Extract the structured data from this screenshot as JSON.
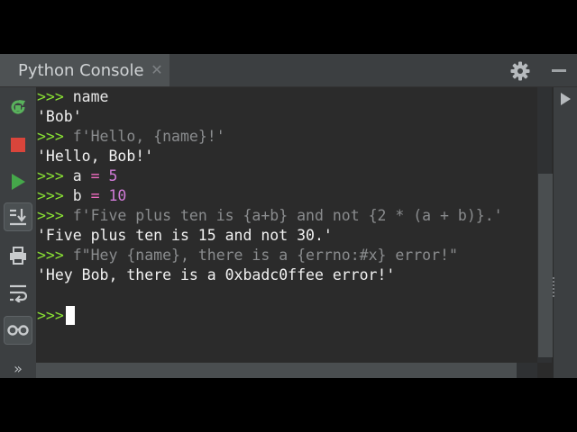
{
  "tab": {
    "title": "Python Console",
    "close_glyph": "✕"
  },
  "toolbar": {
    "icons": [
      "rerun-icon",
      "stop-icon",
      "run-icon",
      "scroll-to-end-icon",
      "print-icon",
      "soft-wrap-icon",
      "variables-icon",
      "more-icon"
    ],
    "more_glyph": "»"
  },
  "console": {
    "prompt": ">>>",
    "lines": [
      {
        "kind": "input",
        "text": " name"
      },
      {
        "kind": "output",
        "text": "'Bob'"
      },
      {
        "kind": "input",
        "text": " f'Hello, {name}!'"
      },
      {
        "kind": "output",
        "text": "'Hello, Bob!'"
      },
      {
        "kind": "assign",
        "var": " a ",
        "op": "=",
        "value": " 5"
      },
      {
        "kind": "assign",
        "var": " b ",
        "op": "=",
        "value": " 10"
      },
      {
        "kind": "input",
        "text": " f'Five plus ten is {a+b} and not {2 * (a + b)}.'"
      },
      {
        "kind": "output",
        "text": "'Five plus ten is 15 and not 30.'"
      },
      {
        "kind": "input",
        "text": " f\"Hey {name}, there is a {errno:#x} error!\""
      },
      {
        "kind": "output",
        "text": "'Hey Bob, there is a 0xbadc0ffee error!'"
      }
    ],
    "active_prompt": ">>>"
  },
  "colors": {
    "prompt": "#8ae234",
    "string_literal": "#8a8c8e",
    "operator": "#f16cc2",
    "number": "#d17bd8",
    "background": "#2b2b2b"
  }
}
